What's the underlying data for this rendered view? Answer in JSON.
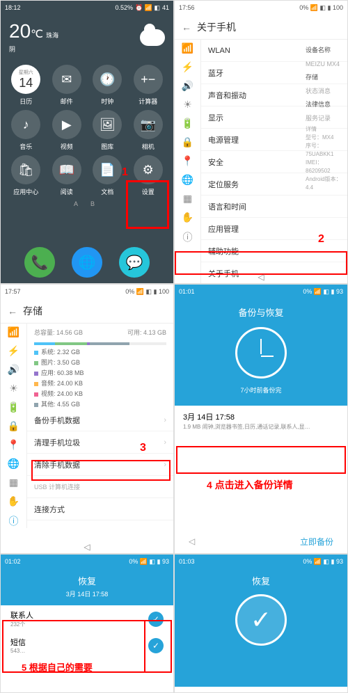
{
  "p1": {
    "time": "18:12",
    "pct": "0.52%",
    "bat": "41",
    "temp": "20",
    "unit": "℃",
    "city": "珠海",
    "cond": "阴",
    "day": "星期六",
    "date": "14",
    "apps": [
      {
        "n": "日历",
        "i": "📅"
      },
      {
        "n": "邮件",
        "i": "✉"
      },
      {
        "n": "时钟",
        "i": "🕐"
      },
      {
        "n": "计算器",
        "i": "+−"
      },
      {
        "n": "音乐",
        "i": "♪"
      },
      {
        "n": "视频",
        "i": "▶"
      },
      {
        "n": "图库",
        "i": "🖼"
      },
      {
        "n": "相机",
        "i": "📷"
      },
      {
        "n": "应用中心",
        "i": "🛍"
      },
      {
        "n": "阅读",
        "i": "📖"
      },
      {
        "n": "文档",
        "i": "📄"
      },
      {
        "n": "设置",
        "i": "⚙"
      }
    ],
    "mark": "1",
    "ab": "A   B"
  },
  "p2": {
    "time": "17:56",
    "bat": "100",
    "title": "关于手机",
    "items": [
      "WLAN",
      "蓝牙",
      "声音和振动",
      "显示",
      "电源管理",
      "安全",
      "定位服务",
      "语言和时间",
      "应用管理",
      "辅助功能",
      "关于手机"
    ],
    "icons": [
      "📶",
      "⚡",
      "🔊",
      "☀",
      "🔋",
      "🔒",
      "📍",
      "🌐",
      "▦",
      "✋",
      "ⓘ"
    ],
    "side": [
      "设备名称",
      "MEIZU MX4",
      "存储",
      "状态消息",
      "法律信息",
      "服务记录"
    ],
    "detail": [
      "详情",
      "型号：MX4",
      "序号：75UABKK1",
      "IMEI：86209502",
      "Android版本：4.4"
    ],
    "mark": "2"
  },
  "p3": {
    "time": "17:57",
    "bat": "100",
    "title": "存储",
    "total": "总容量: 14.56 GB",
    "free": "可用: 4.13 GB",
    "legend": [
      [
        "#4fc3f7",
        "系统: 2.32 GB"
      ],
      [
        "#81c784",
        "图片: 3.50 GB"
      ],
      [
        "#9575cd",
        "应用: 60.38 MB"
      ],
      [
        "#ffb74d",
        "音频: 24.00 KB"
      ],
      [
        "#f06292",
        "视频: 24.00 KB"
      ],
      [
        "#90a4ae",
        "其他: 4.55 GB"
      ]
    ],
    "actions": [
      "备份手机数据",
      "清理手机垃圾",
      "清除手机数据"
    ],
    "usb": "USB 计算机连接",
    "conn": "连接方式",
    "mark": "3"
  },
  "p4": {
    "time": "01:01",
    "bat": "93",
    "title": "备份与恢复",
    "ago": "7小时前备份完",
    "date": "3月 14日  17:58",
    "desc": "1.9 MB 闹钟,浏览器书签,日历,通话记录,联系人,显…",
    "tip": "4 点击进入备份详情",
    "btn": "立即备份"
  },
  "p5": {
    "time": "01:02",
    "bat": "93",
    "title": "恢复",
    "sub": "3月 14日  17:58",
    "items": [
      [
        "联系人",
        "232个"
      ],
      [
        "短信",
        "543…"
      ]
    ],
    "tip": "5 根据自己的需要"
  },
  "p6": {
    "time": "01:03",
    "bat": "93",
    "title": "恢复"
  }
}
